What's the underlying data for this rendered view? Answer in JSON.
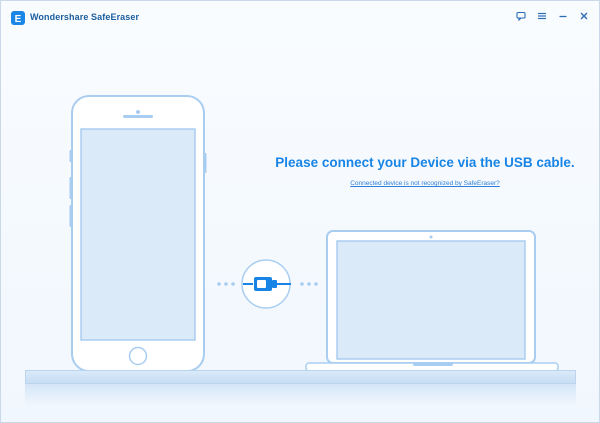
{
  "app": {
    "title": "Wondershare SafeEraser",
    "logo_letter": "E"
  },
  "window_controls": {
    "feedback_icon": "chat-bubble-icon",
    "menu_icon": "hamburger-menu-icon",
    "minimize_icon": "minimize-icon",
    "close_icon": "close-icon"
  },
  "main": {
    "headline": "Please connect your Device via the USB cable.",
    "help_link": "Connected device is not recognized by SafeEraser?"
  },
  "illustration": {
    "phone": "smartphone-illustration",
    "laptop": "laptop-illustration",
    "cable": "usb-cable-icon"
  },
  "colors": {
    "accent": "#1784e6",
    "outline": "#a9cdf0",
    "screen_fill": "#dbeaf8",
    "background": "#f5f9fd"
  }
}
